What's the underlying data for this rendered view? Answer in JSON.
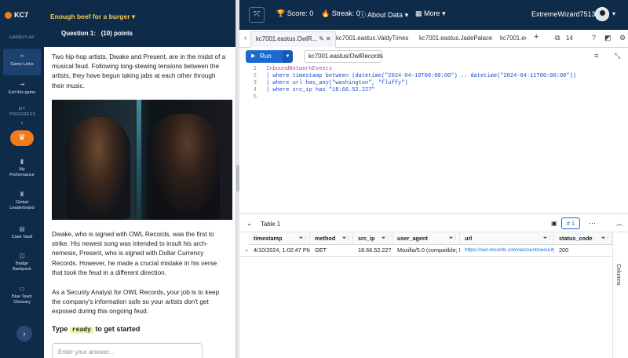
{
  "sidebar": {
    "brand": "KC7",
    "section_gameplay": "GAMEPLAY",
    "game_links": "Game Links",
    "exit_game": "Exit this game",
    "section_progress": "MY PROGRESS",
    "my_performance": "My Performance",
    "global_leaderboard": "Global Leaderboard",
    "case_vault": "Case Vault",
    "badge_backpack": "Badge Backpack",
    "blue_team_glossary": "Blue Team Glossary"
  },
  "question": {
    "title": "Enough beef for a burger",
    "number": "Question 1:",
    "points": "(10) points",
    "para1": "Two hip-hop artists, Dwake and Present, are in the midst of a musical feud. Following long-stewing tensions between the artists, they have begun taking jabs at each other through their music.",
    "para2": "Dwake, who is signed with OWL Records, was the first to strike. His newest song was intended to insult his arch-nemesis, Present, who is signed with Dollar Currency Records. However, he made a crucial mistake in his verse that took the feud in a different direction.",
    "para3": "As a Security Analyst for OWL Records, your job is to keep the company's information safe so your artists don't get exposed during this ongoing feud.",
    "type_prefix": "Type",
    "type_keyword": "ready",
    "type_suffix": "to get started",
    "answer_placeholder": "Enter your answer..."
  },
  "topbar": {
    "score": "Score: 0",
    "streak": "Streak: 0",
    "about_data": "About Data",
    "more": "More",
    "username": "ExtremeWizard7513"
  },
  "tabs": {
    "items": [
      "kc7001.eastus.OwlR...",
      "kc7001.eastus.ValdyTimes",
      "kc7001.eastus.JadePalace",
      "kc7001.e"
    ],
    "count": "14"
  },
  "query": {
    "run_label": "Run",
    "database": "kc7001.eastus/OwlRecords",
    "lines": [
      {
        "num": "1",
        "text": "InboundNetworkEvents"
      },
      {
        "num": "2",
        "text": "| where timestamp between (datetime(\"2024-04-10T00:00:00\") .. datetime(\"2024-04-11T00:00:00\"))"
      },
      {
        "num": "3",
        "text": "| where url has_any(\"washington\", \"fluffy\")"
      },
      {
        "num": "4",
        "text": "| where src_ip has \"18.66.52.227\""
      },
      {
        "num": "5",
        "text": ""
      }
    ]
  },
  "results": {
    "table_name": "Table 1",
    "result_count": "1",
    "columns": [
      "timestamp",
      "method",
      "src_ip",
      "user_agent",
      "url",
      "status_code"
    ],
    "row": {
      "timestamp": "4/10/2024, 1:02:47 PM",
      "method": "GET",
      "src_ip": "18.66.52.227",
      "user_agent": "Mozilla/5.0 (compatible; MS",
      "url": "https://owl-records.com/account/security",
      "status_code": "200"
    },
    "columns_panel": "Columns"
  },
  "colors": {
    "navy": "#0e2b4a",
    "accent_orange": "#f07c1c",
    "run_blue": "#1a6ad1",
    "title_yellow": "#f7c948"
  }
}
